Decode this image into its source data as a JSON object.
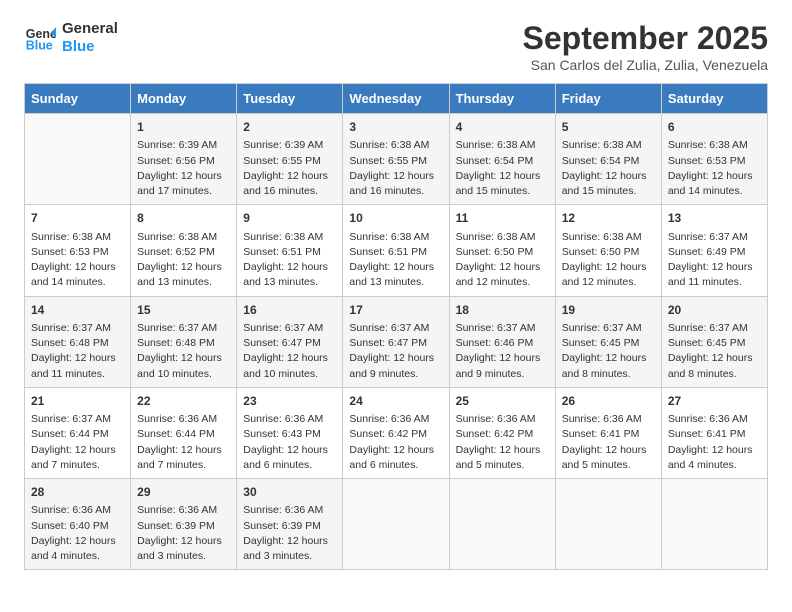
{
  "header": {
    "logo_line1": "General",
    "logo_line2": "Blue",
    "month_title": "September 2025",
    "subtitle": "San Carlos del Zulia, Zulia, Venezuela"
  },
  "days_of_week": [
    "Sunday",
    "Monday",
    "Tuesday",
    "Wednesday",
    "Thursday",
    "Friday",
    "Saturday"
  ],
  "weeks": [
    [
      {
        "day": "",
        "info": ""
      },
      {
        "day": "1",
        "info": "Sunrise: 6:39 AM\nSunset: 6:56 PM\nDaylight: 12 hours\nand 17 minutes."
      },
      {
        "day": "2",
        "info": "Sunrise: 6:39 AM\nSunset: 6:55 PM\nDaylight: 12 hours\nand 16 minutes."
      },
      {
        "day": "3",
        "info": "Sunrise: 6:38 AM\nSunset: 6:55 PM\nDaylight: 12 hours\nand 16 minutes."
      },
      {
        "day": "4",
        "info": "Sunrise: 6:38 AM\nSunset: 6:54 PM\nDaylight: 12 hours\nand 15 minutes."
      },
      {
        "day": "5",
        "info": "Sunrise: 6:38 AM\nSunset: 6:54 PM\nDaylight: 12 hours\nand 15 minutes."
      },
      {
        "day": "6",
        "info": "Sunrise: 6:38 AM\nSunset: 6:53 PM\nDaylight: 12 hours\nand 14 minutes."
      }
    ],
    [
      {
        "day": "7",
        "info": "Sunrise: 6:38 AM\nSunset: 6:53 PM\nDaylight: 12 hours\nand 14 minutes."
      },
      {
        "day": "8",
        "info": "Sunrise: 6:38 AM\nSunset: 6:52 PM\nDaylight: 12 hours\nand 13 minutes."
      },
      {
        "day": "9",
        "info": "Sunrise: 6:38 AM\nSunset: 6:51 PM\nDaylight: 12 hours\nand 13 minutes."
      },
      {
        "day": "10",
        "info": "Sunrise: 6:38 AM\nSunset: 6:51 PM\nDaylight: 12 hours\nand 13 minutes."
      },
      {
        "day": "11",
        "info": "Sunrise: 6:38 AM\nSunset: 6:50 PM\nDaylight: 12 hours\nand 12 minutes."
      },
      {
        "day": "12",
        "info": "Sunrise: 6:38 AM\nSunset: 6:50 PM\nDaylight: 12 hours\nand 12 minutes."
      },
      {
        "day": "13",
        "info": "Sunrise: 6:37 AM\nSunset: 6:49 PM\nDaylight: 12 hours\nand 11 minutes."
      }
    ],
    [
      {
        "day": "14",
        "info": "Sunrise: 6:37 AM\nSunset: 6:48 PM\nDaylight: 12 hours\nand 11 minutes."
      },
      {
        "day": "15",
        "info": "Sunrise: 6:37 AM\nSunset: 6:48 PM\nDaylight: 12 hours\nand 10 minutes."
      },
      {
        "day": "16",
        "info": "Sunrise: 6:37 AM\nSunset: 6:47 PM\nDaylight: 12 hours\nand 10 minutes."
      },
      {
        "day": "17",
        "info": "Sunrise: 6:37 AM\nSunset: 6:47 PM\nDaylight: 12 hours\nand 9 minutes."
      },
      {
        "day": "18",
        "info": "Sunrise: 6:37 AM\nSunset: 6:46 PM\nDaylight: 12 hours\nand 9 minutes."
      },
      {
        "day": "19",
        "info": "Sunrise: 6:37 AM\nSunset: 6:45 PM\nDaylight: 12 hours\nand 8 minutes."
      },
      {
        "day": "20",
        "info": "Sunrise: 6:37 AM\nSunset: 6:45 PM\nDaylight: 12 hours\nand 8 minutes."
      }
    ],
    [
      {
        "day": "21",
        "info": "Sunrise: 6:37 AM\nSunset: 6:44 PM\nDaylight: 12 hours\nand 7 minutes."
      },
      {
        "day": "22",
        "info": "Sunrise: 6:36 AM\nSunset: 6:44 PM\nDaylight: 12 hours\nand 7 minutes."
      },
      {
        "day": "23",
        "info": "Sunrise: 6:36 AM\nSunset: 6:43 PM\nDaylight: 12 hours\nand 6 minutes."
      },
      {
        "day": "24",
        "info": "Sunrise: 6:36 AM\nSunset: 6:42 PM\nDaylight: 12 hours\nand 6 minutes."
      },
      {
        "day": "25",
        "info": "Sunrise: 6:36 AM\nSunset: 6:42 PM\nDaylight: 12 hours\nand 5 minutes."
      },
      {
        "day": "26",
        "info": "Sunrise: 6:36 AM\nSunset: 6:41 PM\nDaylight: 12 hours\nand 5 minutes."
      },
      {
        "day": "27",
        "info": "Sunrise: 6:36 AM\nSunset: 6:41 PM\nDaylight: 12 hours\nand 4 minutes."
      }
    ],
    [
      {
        "day": "28",
        "info": "Sunrise: 6:36 AM\nSunset: 6:40 PM\nDaylight: 12 hours\nand 4 minutes."
      },
      {
        "day": "29",
        "info": "Sunrise: 6:36 AM\nSunset: 6:39 PM\nDaylight: 12 hours\nand 3 minutes."
      },
      {
        "day": "30",
        "info": "Sunrise: 6:36 AM\nSunset: 6:39 PM\nDaylight: 12 hours\nand 3 minutes."
      },
      {
        "day": "",
        "info": ""
      },
      {
        "day": "",
        "info": ""
      },
      {
        "day": "",
        "info": ""
      },
      {
        "day": "",
        "info": ""
      }
    ]
  ]
}
